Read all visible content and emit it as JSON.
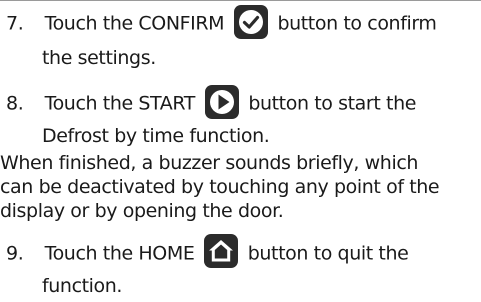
{
  "colors": {
    "text": "#1a1a1a",
    "icon_fill": "#2b2b2b",
    "icon_glyph": "#ffffff"
  },
  "steps": [
    {
      "number": "7.",
      "line1_before": "Touch the CONFIRM",
      "icon": "checkmark-circle-icon",
      "line1_after": "button to confirm",
      "line2": "the settings."
    },
    {
      "number": "8.",
      "line1_before": "Touch the START",
      "icon": "play-circle-icon",
      "line1_after": "button to start the",
      "line2": "Defrost by time function."
    },
    {
      "number": "9.",
      "line1_before": "Touch the HOME",
      "icon": "home-icon",
      "line1_after": "button to quit the",
      "line2": "function."
    }
  ],
  "note": {
    "line1": "When finished, a buzzer sounds briefly, which",
    "line2": "can be deactivated by touching any point of the",
    "line3": "display or by opening the door."
  }
}
